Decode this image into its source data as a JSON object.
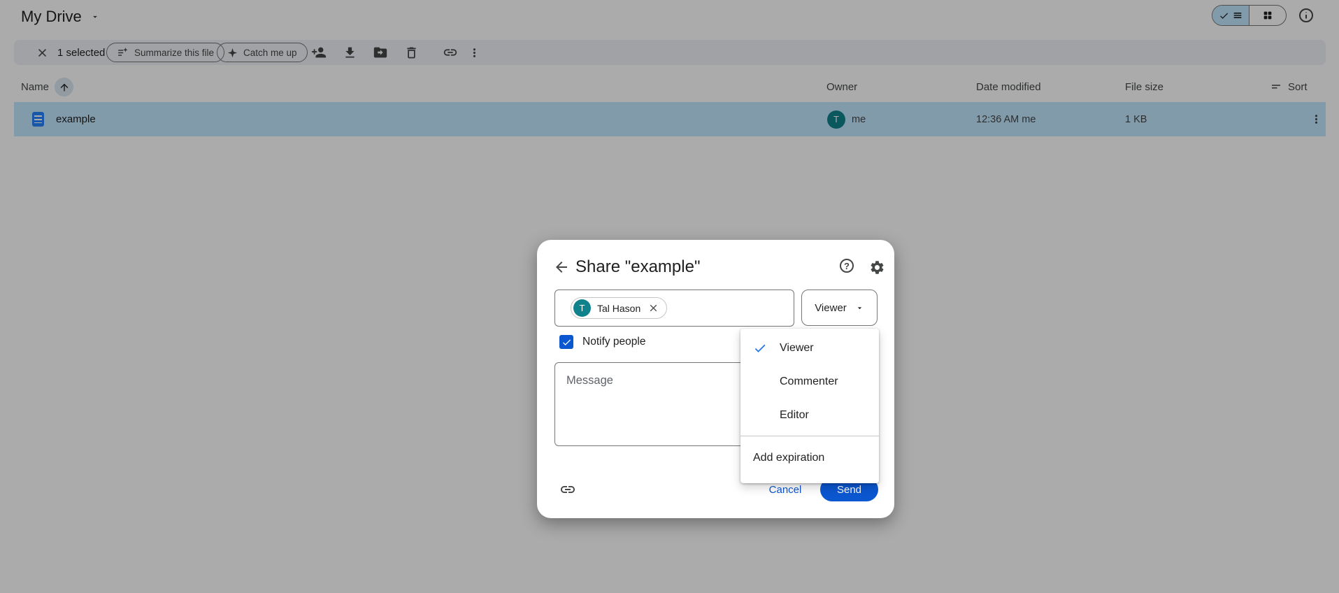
{
  "topbar": {
    "title": "My Drive"
  },
  "toolbar": {
    "selected_count": "1 selected",
    "summarize_label": "Summarize this file",
    "catch_me_up_label": "Catch me up"
  },
  "table": {
    "headers": {
      "name": "Name",
      "owner": "Owner",
      "date_modified": "Date modified",
      "file_size": "File size",
      "sort": "Sort"
    },
    "rows": [
      {
        "name": "example",
        "owner_initial": "T",
        "owner": "me",
        "date_modified": "12:36 AM me",
        "file_size": "1 KB"
      }
    ]
  },
  "share_dialog": {
    "title": "Share \"example\"",
    "recipient": {
      "initial": "T",
      "name": "Tal Hason"
    },
    "role_selector_value": "Viewer",
    "notify_label": "Notify people",
    "message_placeholder": "Message",
    "cancel_label": "Cancel",
    "send_label": "Send"
  },
  "role_menu": {
    "options": [
      {
        "label": "Viewer",
        "checked": true
      },
      {
        "label": "Commenter",
        "checked": false
      },
      {
        "label": "Editor",
        "checked": false
      }
    ],
    "add_expiration_label": "Add expiration"
  },
  "colors": {
    "accent_blue": "#0b57d0",
    "menu_check_blue": "#1a73e8",
    "selection_blue": "#c2e7ff",
    "avatar_teal": "#0f828c",
    "doc_icon_blue": "#2684fc"
  }
}
